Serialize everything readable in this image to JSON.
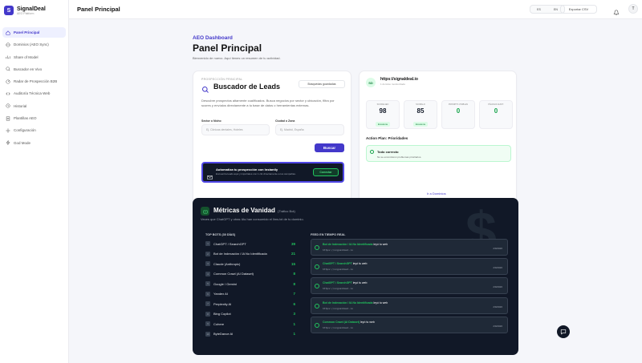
{
  "brand": {
    "name": "SignalDeal",
    "sub": "AEO Platform"
  },
  "nav": [
    {
      "label": "Panel Principal",
      "icon": "home-icon",
      "active": true
    },
    {
      "label": "Dominios (AEO Sync)",
      "icon": "globe-icon"
    },
    {
      "label": "Share of Model",
      "icon": "chart-icon"
    },
    {
      "label": "Buscador en Vivo",
      "icon": "search-icon"
    },
    {
      "label": "Radar de Prospección B2B",
      "icon": "radar-icon"
    },
    {
      "label": "Auditoría Técnica Web",
      "icon": "code-icon"
    },
    {
      "label": "Historial",
      "icon": "history-icon"
    },
    {
      "label": "Plantillas AEO",
      "icon": "template-icon"
    },
    {
      "label": "Configuración",
      "icon": "gear-icon"
    },
    {
      "label": "God Mode",
      "icon": "bolt-icon"
    }
  ],
  "topbar": {
    "title": "Panel Principal",
    "lang_es": "ES",
    "lang_en": "EN",
    "export": "Exportar CSV",
    "avatar": "T"
  },
  "dashboard": {
    "label": "AEO Dashboard",
    "title": "Panel Principal",
    "subtitle": "Bienvenido de nuevo. Aquí tienes un resumen de tu actividad."
  },
  "leads": {
    "overline": "PROSPECCIÓN PRINCIPAL",
    "title": "Buscador de Leads",
    "saved": "Búsquedas guardadas",
    "desc": "Descubre prospectos altamente cualificados. Busca negocios por sector y ubicación, filtra por scores y envíalos directamente a tu base de datos o herramientas externas.",
    "sector_label": "Sector o Nicho",
    "sector_ph": "Ej. Clínicas dentales, Hoteles",
    "city_label": "Ciudad o Zona",
    "city_ph": "Ej. Madrid, España",
    "search": "Buscar",
    "banner_title": "Automatiza tu prospección con Instantly",
    "banner_sub": "Encuentra leads aquí y impórtalos con 1 clic directamente a tus campañas.",
    "banner_btn": "Conectar"
  },
  "domain": {
    "initials": "SD",
    "url": "https://signaldeal.io",
    "sub": "1 dominio monitorizado",
    "metrics": [
      {
        "label": "SCORE AEO",
        "value": "98",
        "badge": "Excelente",
        "color": "#111827"
      },
      {
        "label": "SCORE AI",
        "value": "85",
        "badge": "Excelente",
        "color": "#111827"
      },
      {
        "label": "PROMPTS VISIBLES",
        "value": "0",
        "badge": "",
        "color": "#16a34a"
      },
      {
        "label": "PÁGINAS AUDIT.",
        "value": "0",
        "badge": "",
        "color": "#16a34a"
      }
    ],
    "plan_title": "Action Plan: Prioridades",
    "plan_ok": "Todo correcto",
    "plan_desc": "No se encontraron problemas prioritarios.",
    "link": "Ir a Dominios"
  },
  "vanity": {
    "title": "Métricas de Vanidad",
    "tag": "(Tráfico Bot)",
    "sub": "Veces que ChatGPT y otras IAs han consumido el llms.txt de tu dominio.",
    "bots_head": "TOP BOTS (30 DÍAS)",
    "bots": [
      {
        "n": "1",
        "name": "ChatGPT / SearchGPT",
        "count": "39"
      },
      {
        "n": "2",
        "name": "Bot de Indexación / IA No Identificada",
        "count": "21"
      },
      {
        "n": "3",
        "name": "Claude (Anthropic)",
        "count": "15"
      },
      {
        "n": "4",
        "name": "Common Crawl (AI Dataset)",
        "count": "8"
      },
      {
        "n": "5",
        "name": "Google / Gemini",
        "count": "8"
      },
      {
        "n": "6",
        "name": "Yandex AI",
        "count": "7"
      },
      {
        "n": "7",
        "name": "Perplexity AI",
        "count": "6"
      },
      {
        "n": "8",
        "name": "Bing Copilot",
        "count": "3"
      },
      {
        "n": "9",
        "name": "Cohere",
        "count": "1"
      },
      {
        "n": "10",
        "name": "ByteDance AI",
        "count": "1"
      }
    ],
    "feed_head": "FEED EN TIEMPO REAL",
    "feed": [
      {
        "bot": "Bot de Indexación / IA No Identificada",
        "action": " leyó tu web",
        "url": "https://signaldeal.io",
        "date": "2/9/2026"
      },
      {
        "bot": "ChatGPT / SearchGPT",
        "action": " leyó tu web",
        "url": "https://signaldeal.io",
        "date": "2/9/2026"
      },
      {
        "bot": "ChatGPT / SearchGPT",
        "action": " leyó tu web",
        "url": "https://signaldeal.io",
        "date": "2/9/2026"
      },
      {
        "bot": "Bot de Indexación / IA No Identificada",
        "action": " leyó tu web",
        "url": "https://signaldeal.io",
        "date": "2/9/2026"
      },
      {
        "bot": "Common Crawl (AI Dataset)",
        "action": " leyó tu web",
        "url": "https://signaldeal.io",
        "date": "2/9/2026"
      }
    ]
  }
}
